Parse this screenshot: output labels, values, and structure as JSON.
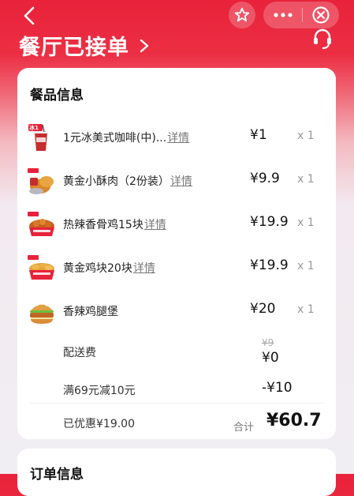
{
  "header": {
    "title": "餐厅已接单",
    "back_icon": "chevron-left-icon",
    "favorite_icon": "star-icon",
    "more_icon": "more-dots-icon",
    "close_icon": "close-circle-icon",
    "service_icon": "headset-icon"
  },
  "food_section": {
    "title": "餐品信息",
    "items": [
      {
        "name": "1元冰美式咖啡(中)...",
        "detail": "详情",
        "price": "¥1",
        "qty": "x 1",
        "thumb_badge": "冰1"
      },
      {
        "name": "黄金小酥肉（2份装）",
        "detail": "详情",
        "price": "¥9.9",
        "qty": "x 1"
      },
      {
        "name": "热辣香骨鸡15块",
        "detail": "详情",
        "price": "¥19.9",
        "qty": "x 1"
      },
      {
        "name": "黄金鸡块20块",
        "detail": "详情",
        "price": "¥19.9",
        "qty": "x 1"
      },
      {
        "name": "香辣鸡腿堡",
        "detail": "",
        "price": "¥20",
        "qty": "x 1"
      }
    ],
    "delivery": {
      "label": "配送费",
      "original": "¥9",
      "current": "¥0"
    },
    "promotion": {
      "label": "满69元减10元",
      "value": "-¥10"
    },
    "saved": "已优惠¥19.00",
    "total_label": "合计",
    "total_value": "¥60.7"
  },
  "order_section": {
    "title": "订单信息"
  },
  "colors": {
    "brand_red": "#e8223a",
    "background": "#f1eef3"
  }
}
